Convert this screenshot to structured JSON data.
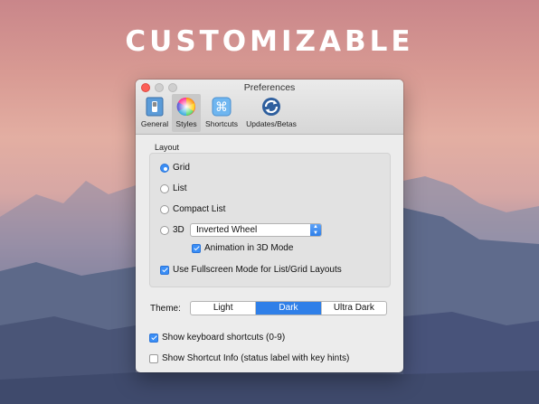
{
  "headline": "CUSTOMIZABLE",
  "window": {
    "title": "Preferences",
    "toolbar": [
      {
        "label": "General",
        "icon": "general-switch-icon",
        "selected": false
      },
      {
        "label": "Styles",
        "icon": "color-wheel-icon",
        "selected": true
      },
      {
        "label": "Shortcuts",
        "icon": "command-key-icon",
        "selected": false
      },
      {
        "label": "Updates/Betas",
        "icon": "sync-arrows-icon",
        "selected": false
      }
    ]
  },
  "layout": {
    "section_label": "Layout",
    "options": [
      {
        "label": "Grid",
        "selected": true
      },
      {
        "label": "List",
        "selected": false
      },
      {
        "label": "Compact List",
        "selected": false
      },
      {
        "label": "3D",
        "selected": false
      }
    ],
    "mode_3d_select": "Inverted Wheel",
    "animation_3d_label": "Animation in 3D Mode",
    "animation_3d_checked": true,
    "fullscreen_label": "Use Fullscreen Mode for List/Grid Layouts",
    "fullscreen_checked": true
  },
  "theme": {
    "label": "Theme:",
    "options": [
      {
        "label": "Light",
        "selected": false
      },
      {
        "label": "Dark",
        "selected": true
      },
      {
        "label": "Ultra Dark",
        "selected": false
      }
    ]
  },
  "keyboard_shortcuts": {
    "label": "Show keyboard shortcuts (0-9)",
    "checked": true
  },
  "shortcut_info": {
    "label": "Show Shortcut Info (status label with key hints)",
    "checked": false
  },
  "colors": {
    "accent": "#2f7fe8",
    "close": "#fc5f57"
  }
}
